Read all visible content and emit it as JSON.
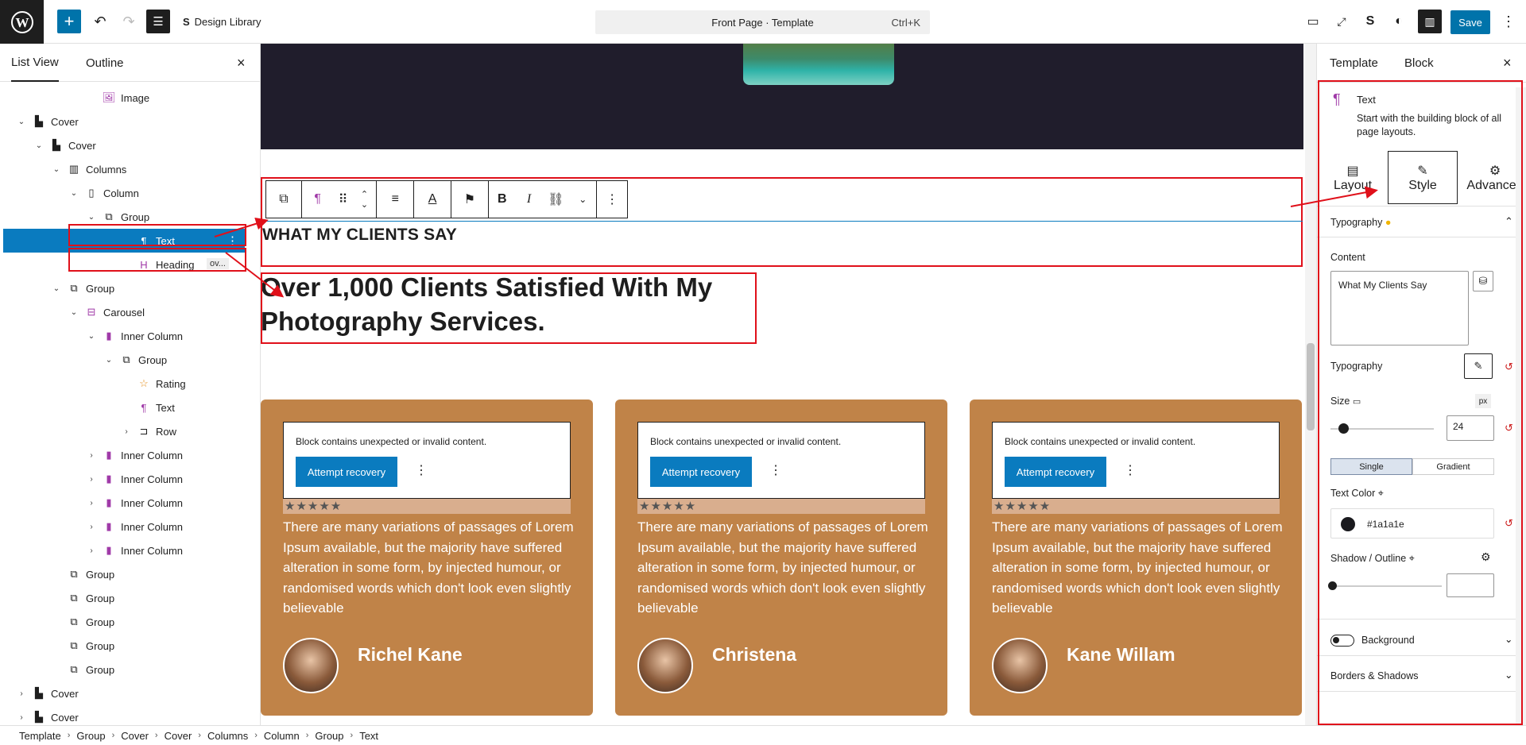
{
  "topbar": {
    "logo": "W",
    "design_library": "Design Library",
    "doc_title": "Front Page · Template",
    "shortcut": "Ctrl+K",
    "save_label": "Save"
  },
  "left_panel": {
    "tabs": [
      "List View",
      "Outline"
    ],
    "close": "×",
    "items": [
      {
        "label": "Image",
        "icon": "image-icon",
        "depth": 5
      },
      {
        "label": "Cover",
        "icon": "cover-icon",
        "depth": 1,
        "caret": "expanded"
      },
      {
        "label": "Cover",
        "icon": "cover-icon",
        "depth": 2,
        "caret": "expanded"
      },
      {
        "label": "Columns",
        "icon": "columns-icon",
        "depth": 3,
        "caret": "expanded"
      },
      {
        "label": "Column",
        "icon": "column-icon",
        "depth": 4,
        "caret": "expanded"
      },
      {
        "label": "Group",
        "icon": "group-icon",
        "depth": 5,
        "caret": "expanded"
      },
      {
        "label": "Text",
        "icon": "paragraph-icon",
        "depth": 7,
        "selected": true
      },
      {
        "label": "Heading",
        "icon": "heading-icon",
        "depth": 7,
        "badge": "ov..."
      },
      {
        "label": "Group",
        "icon": "group-icon",
        "depth": 3,
        "caret": "expanded"
      },
      {
        "label": "Carousel",
        "icon": "carousel-icon",
        "depth": 4,
        "caret": "expanded"
      },
      {
        "label": "Inner Column",
        "icon": "inner-column-icon",
        "depth": 5,
        "caret": "expanded"
      },
      {
        "label": "Group",
        "icon": "group-icon",
        "depth": 6,
        "caret": "expanded"
      },
      {
        "label": "Rating",
        "icon": "star-icon",
        "depth": 7
      },
      {
        "label": "Text",
        "icon": "paragraph-icon",
        "depth": 7
      },
      {
        "label": "Row",
        "icon": "row-icon",
        "depth": 7,
        "caret": "collapsed"
      },
      {
        "label": "Inner Column",
        "icon": "inner-column-icon",
        "depth": 5,
        "caret": "collapsed"
      },
      {
        "label": "Inner Column",
        "icon": "inner-column-icon",
        "depth": 5,
        "caret": "collapsed"
      },
      {
        "label": "Inner Column",
        "icon": "inner-column-icon",
        "depth": 5,
        "caret": "collapsed"
      },
      {
        "label": "Inner Column",
        "icon": "inner-column-icon",
        "depth": 5,
        "caret": "collapsed"
      },
      {
        "label": "Inner Column",
        "icon": "inner-column-icon",
        "depth": 5,
        "caret": "collapsed"
      },
      {
        "label": "Group",
        "icon": "group-icon",
        "depth": 3
      },
      {
        "label": "Group",
        "icon": "group-icon",
        "depth": 3
      },
      {
        "label": "Group",
        "icon": "group-icon",
        "depth": 3
      },
      {
        "label": "Group",
        "icon": "group-icon",
        "depth": 3
      },
      {
        "label": "Group",
        "icon": "group-icon",
        "depth": 3
      },
      {
        "label": "Cover",
        "icon": "cover-icon",
        "depth": 1,
        "caret": "collapsed"
      },
      {
        "label": "Cover",
        "icon": "cover-icon",
        "depth": 1,
        "caret": "collapsed"
      }
    ]
  },
  "canvas": {
    "subheading": "WHAT MY CLIENTS SAY",
    "heading": "Over 1,000 Clients Satisfied With My Photography Services.",
    "cards": [
      {
        "warning": "Block contains unexpected or invalid content.",
        "recover": "Attempt recovery",
        "stars": "★★★★★",
        "quote": "There are many variations of passages of Lorem Ipsum available, but the majority have suffered alteration in some form, by injected humour, or randomised words which don't look even slightly believable",
        "name": "Richel Kane"
      },
      {
        "warning": "Block contains unexpected or invalid content.",
        "recover": "Attempt recovery",
        "stars": "★★★★★",
        "quote": "There are many variations of passages of Lorem Ipsum available, but the majority have suffered alteration in some form, by injected humour, or randomised words which don't look even slightly believable",
        "name": "Christena"
      },
      {
        "warning": "Block contains unexpected or invalid content.",
        "recover": "Attempt recovery",
        "stars": "★★★★★",
        "quote": "There are many variations of passages of Lorem Ipsum available, but the majority have suffered alteration in some form, by injected humour, or randomised words which don't look even slightly believable",
        "name": "Kane Willam"
      }
    ]
  },
  "right_panel": {
    "tabs": [
      "Template",
      "Block"
    ],
    "block_title": "Text",
    "block_desc": "Start with the building block of all page layouts.",
    "sub_tabs": [
      "Layout",
      "Style",
      "Advanced"
    ],
    "typography_section": "Typography",
    "content_label": "Content",
    "content_value": "What My Clients Say",
    "typography_label": "Typography",
    "size_label": "Size",
    "size_unit": "px",
    "size_value": "24",
    "size_level": 0.12,
    "fill_modes": [
      "Single",
      "Gradient"
    ],
    "text_color_label": "Text Color",
    "text_color_value": "#1a1a1e",
    "shadow_label": "Shadow / Outline",
    "background_label": "Background",
    "borders_label": "Borders & Shadows"
  },
  "breadcrumbs": [
    "Template",
    "Group",
    "Cover",
    "Cover",
    "Columns",
    "Column",
    "Group",
    "Text"
  ],
  "colors": {
    "accent": "#0073aa",
    "annotation": "#e0101a",
    "card": "#c08348"
  }
}
